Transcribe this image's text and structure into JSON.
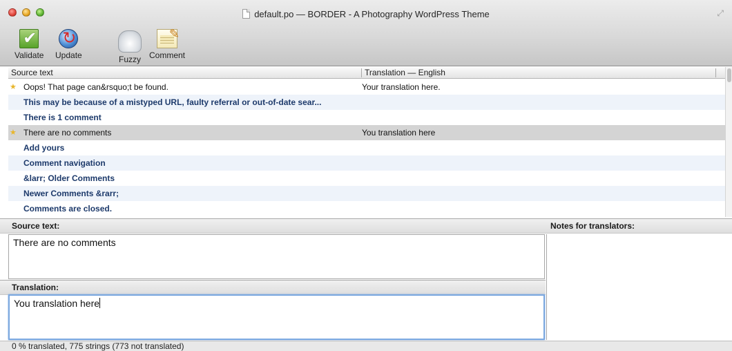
{
  "window": {
    "title": "default.po — BORDER - A Photography WordPress Theme"
  },
  "toolbar": {
    "buttons": [
      {
        "label": "Validate",
        "icon": "validate-checkmark-icon"
      },
      {
        "label": "Update",
        "icon": "update-globe-icon"
      },
      {
        "label": "Fuzzy",
        "icon": "fuzzy-cloud-icon"
      },
      {
        "label": "Comment",
        "icon": "comment-notepad-icon"
      }
    ]
  },
  "list": {
    "headers": {
      "source": "Source text",
      "translation": "Translation — English"
    },
    "rows": [
      {
        "source": "Oops! That page can&rsquo;t be found.",
        "translation": "Your translation here.",
        "starred": true,
        "bold": false,
        "selected": false
      },
      {
        "source": "This may be because of a mistyped URL, faulty referral or out-of-date sear...",
        "translation": "",
        "starred": false,
        "bold": true,
        "selected": false
      },
      {
        "source": "There is 1 comment",
        "translation": "",
        "starred": false,
        "bold": true,
        "selected": false
      },
      {
        "source": "There are no comments",
        "translation": "You translation here",
        "starred": true,
        "bold": false,
        "selected": true
      },
      {
        "source": "Add yours",
        "translation": "",
        "starred": false,
        "bold": true,
        "selected": false
      },
      {
        "source": "Comment navigation",
        "translation": "",
        "starred": false,
        "bold": true,
        "selected": false
      },
      {
        "source": "&larr; Older Comments",
        "translation": "",
        "starred": false,
        "bold": true,
        "selected": false
      },
      {
        "source": "Newer Comments &rarr;",
        "translation": "",
        "starred": false,
        "bold": true,
        "selected": false
      },
      {
        "source": "Comments are closed.",
        "translation": "",
        "starred": false,
        "bold": true,
        "selected": false
      }
    ]
  },
  "editor": {
    "source_label": "Source text:",
    "source_value": "There are no comments",
    "translation_label": "Translation:",
    "translation_value": "You translation here",
    "notes_label": "Notes for translators:"
  },
  "status": {
    "text": "0 % translated, 775 strings (773 not translated)"
  },
  "colors": {
    "alt_row": "#eef3fa",
    "selected_row": "#d4d4d4",
    "untranslated_text": "#1d3a6b",
    "star": "#e8b62b",
    "focus_ring": "#7aa7df"
  }
}
